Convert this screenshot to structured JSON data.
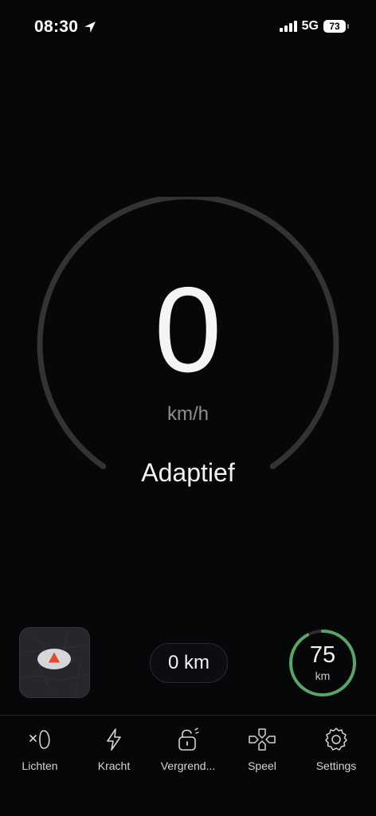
{
  "status_bar": {
    "time": "08:30",
    "network": "5G",
    "battery": "73"
  },
  "speedometer": {
    "speed": "0",
    "unit": "km/h",
    "mode": "Adaptief"
  },
  "trip": {
    "distance": "0 km"
  },
  "range": {
    "value": "75",
    "unit": "km",
    "fraction": 0.92,
    "color": "#5aa566"
  },
  "nav": {
    "items": [
      {
        "label": "Lichten",
        "icon": "light-icon"
      },
      {
        "label": "Kracht",
        "icon": "lightning-icon"
      },
      {
        "label": "Vergrend...",
        "icon": "lock-icon"
      },
      {
        "label": "Speel",
        "icon": "gamepad-icon"
      },
      {
        "label": "Settings",
        "icon": "gear-icon"
      }
    ]
  },
  "colors": {
    "background": "#060709",
    "gauge_track": "#323335",
    "map_marker": "#e04a2e"
  }
}
